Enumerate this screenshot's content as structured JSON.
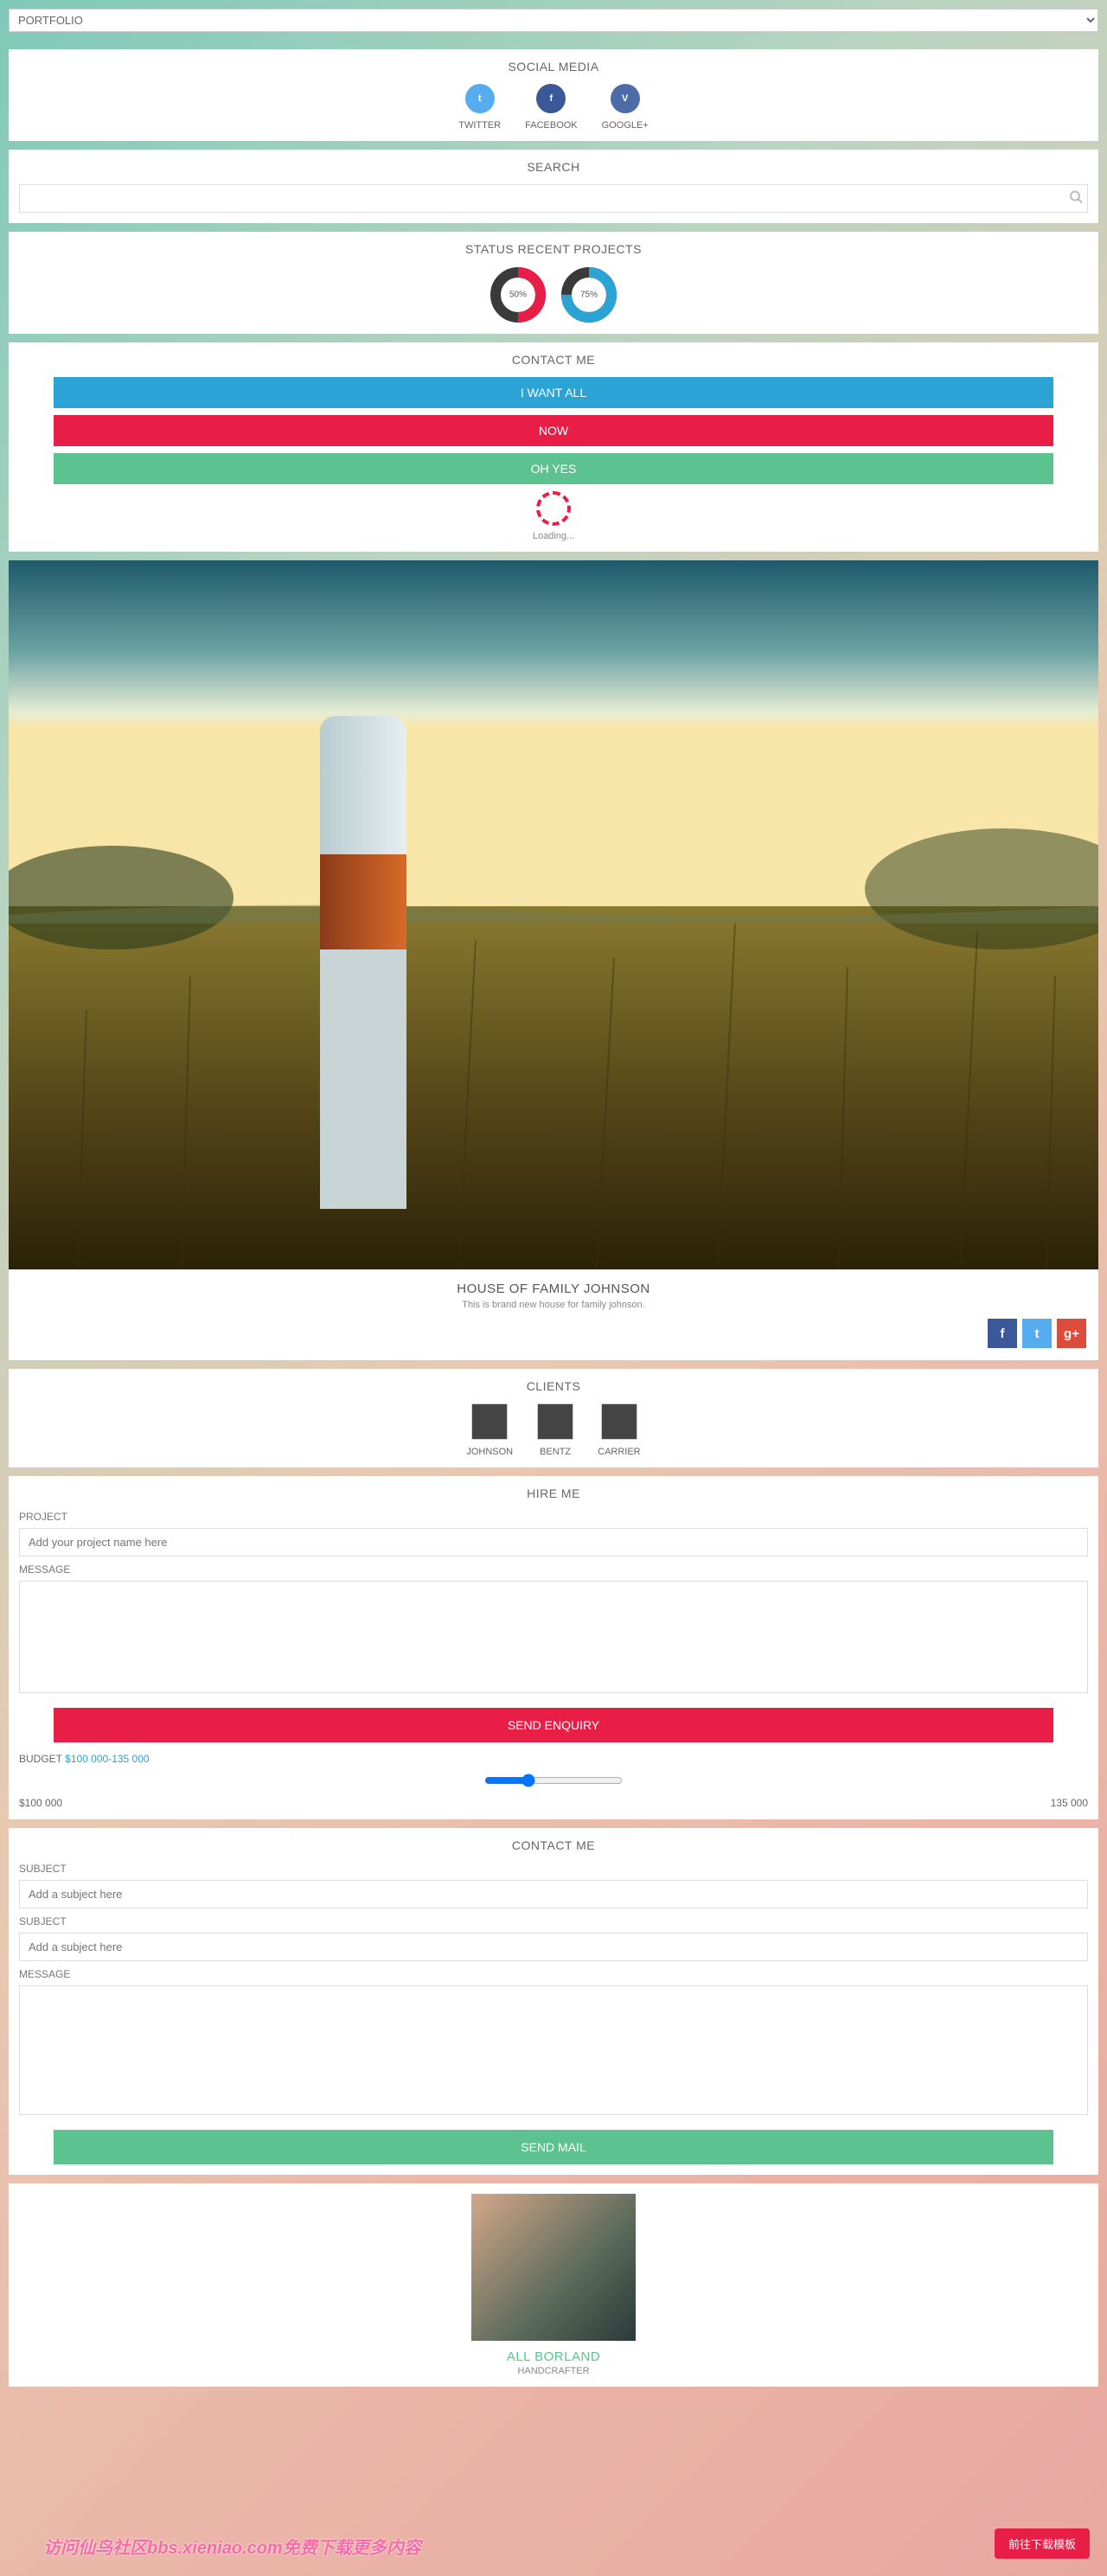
{
  "portfolio_select": {
    "value": "PORTFOLIO"
  },
  "social_media": {
    "title": "SOCIAL MEDIA",
    "items": [
      {
        "label": "TWITTER",
        "color": "#55acee",
        "glyph": "t"
      },
      {
        "label": "FACEBOOK",
        "color": "#3b5998",
        "glyph": "f"
      },
      {
        "label": "GOOGLE+",
        "color": "#4c6ba8",
        "glyph": "V"
      }
    ]
  },
  "search": {
    "title": "SEARCH",
    "placeholder": ""
  },
  "status": {
    "title": "STATUS RECENT PROJECTS",
    "donuts": [
      {
        "percent": 50,
        "label": "50%",
        "color": "#e81e47",
        "bg": "#3a3a3a"
      },
      {
        "percent": 75,
        "label": "75%",
        "color": "#2ba3d4",
        "bg": "#3a3a3a"
      }
    ]
  },
  "contact_me": {
    "title": "CONTACT ME",
    "buttons": [
      {
        "label": "I WANT ALL",
        "cls": "btn-blue"
      },
      {
        "label": "NOW",
        "cls": "btn-red"
      },
      {
        "label": "OH YES",
        "cls": "btn-green"
      }
    ],
    "loading": "Loading..."
  },
  "hero": {
    "title": "HOUSE OF FAMILY JOHNSON",
    "subtitle": "This is brand new house for family johnson.",
    "shares": [
      {
        "name": "facebook",
        "glyph": "f",
        "color": "#3b5998"
      },
      {
        "name": "twitter",
        "glyph": "t",
        "color": "#55acee"
      },
      {
        "name": "google-plus",
        "glyph": "g+",
        "color": "#dd4b39"
      }
    ]
  },
  "clients": {
    "title": "CLIENTS",
    "items": [
      {
        "name": "JOHNSON"
      },
      {
        "name": "BENTZ"
      },
      {
        "name": "CARRIER"
      }
    ]
  },
  "hire": {
    "title": "HIRE ME",
    "project_label": "PROJECT",
    "project_placeholder": "Add your project name here",
    "message_label": "MESSAGE",
    "submit": "SEND ENQUIRY",
    "budget_label": "BUDGET",
    "budget_value": "$100 000-135 000",
    "budget_min": "$100 000",
    "budget_max": "135 000"
  },
  "contact_form": {
    "title": "CONTACT ME",
    "subject_label": "SUBJECT",
    "subject_placeholder": "Add a subject here",
    "subject_label2": "SUBJECT",
    "subject_placeholder2": "Add a subject here",
    "message_label": "MESSAGE",
    "submit": "SEND MAIL"
  },
  "footer": {
    "name": "ALL BORLAND",
    "role": "HANDCRAFTER"
  },
  "watermark": "访问仙鸟社区bbs.xieniao.com免费下载更多内容",
  "float_btn": "前往下载模板"
}
